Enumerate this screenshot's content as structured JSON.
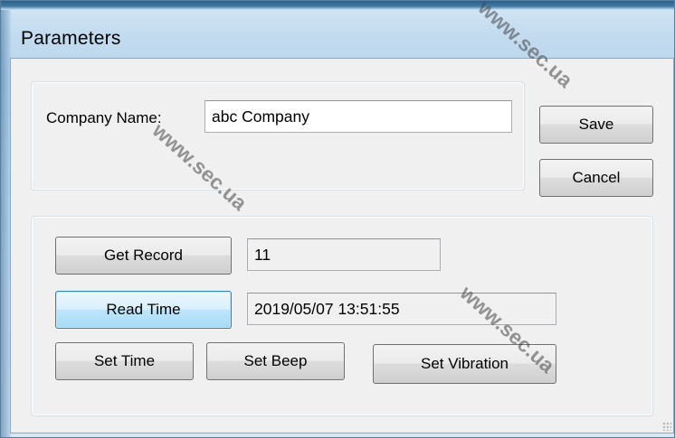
{
  "window": {
    "title": "Parameters"
  },
  "company": {
    "label": "Company Name:",
    "value": "abc Company"
  },
  "dialog_buttons": {
    "save": "Save",
    "cancel": "Cancel"
  },
  "device": {
    "get_record_label": "Get Record",
    "record_value": "11",
    "read_time_label": "Read Time",
    "time_value": "2019/05/07 13:51:55",
    "set_time_label": "Set Time",
    "set_beep_label": "Set Beep",
    "set_vibration_label": "Set Vibration"
  },
  "watermark": {
    "text": "www.sec.ua"
  },
  "colors": {
    "focused_button_border": "#3c7fb1",
    "client_background": "#f0f0f0"
  }
}
